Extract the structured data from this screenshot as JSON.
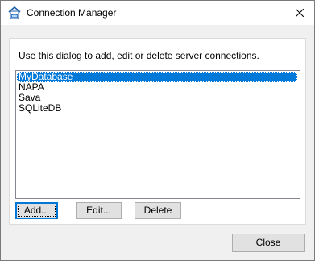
{
  "window": {
    "title": "Connection Manager",
    "icon": "database-connection-icon",
    "close_icon": "close-icon"
  },
  "dialog": {
    "description": "Use this dialog to add, edit or delete server connections.",
    "connections": [
      "MyDatabase",
      "NAPA",
      "Sava",
      "SQLiteDB"
    ],
    "selected": "MyDatabase",
    "buttons": {
      "add": "Add...",
      "edit": "Edit...",
      "delete": "Delete",
      "close": "Close"
    }
  },
  "colors": {
    "selection": "#0078d7",
    "button_face": "#e1e1e1",
    "dialog_bg": "#f0f0f0"
  }
}
